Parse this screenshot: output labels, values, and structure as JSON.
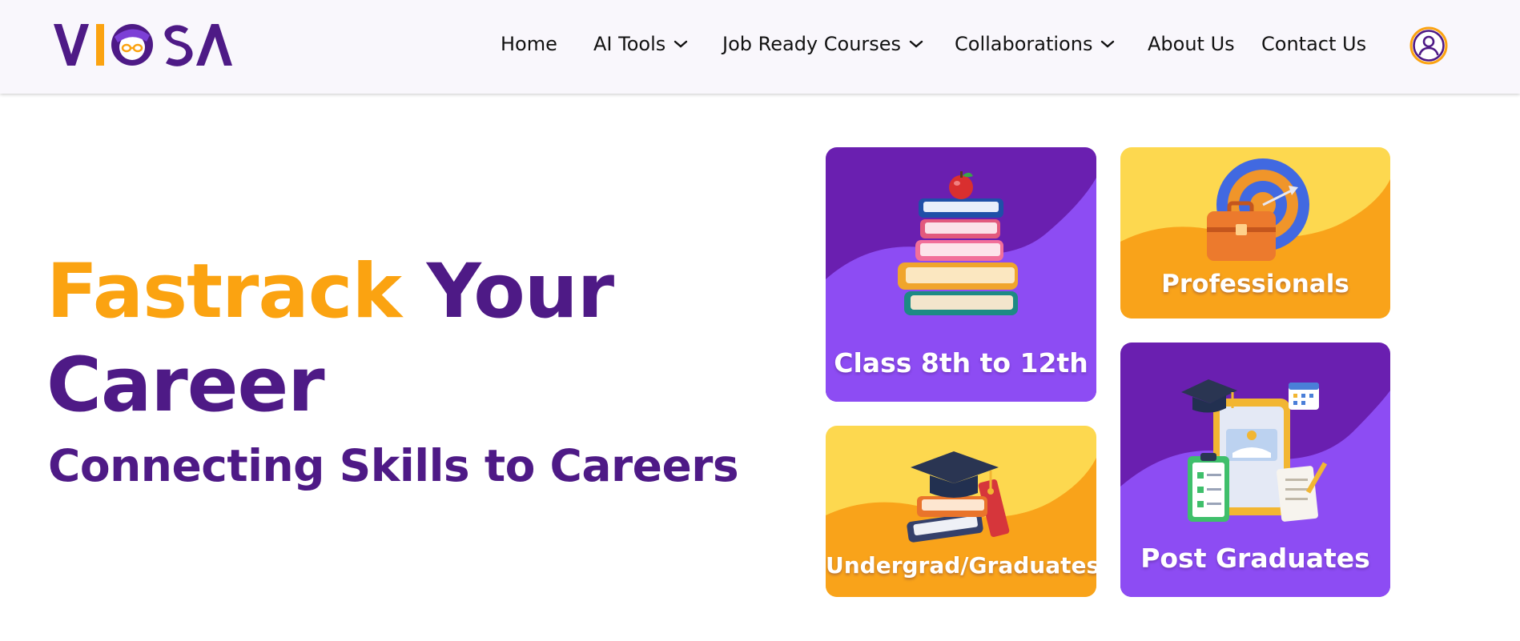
{
  "header": {
    "logo_text": "VIOSA",
    "nav": [
      {
        "label": "Home",
        "has_dropdown": false
      },
      {
        "label": "AI Tools",
        "has_dropdown": true
      },
      {
        "label": "Job Ready Courses",
        "has_dropdown": true
      },
      {
        "label": "Collaborations",
        "has_dropdown": true
      },
      {
        "label": "About Us",
        "has_dropdown": false
      },
      {
        "label": "Contact Us",
        "has_dropdown": false
      }
    ],
    "profile_icon": "user-circle-icon"
  },
  "hero": {
    "word_fastrack": "Fastrack",
    "word_your": "Your",
    "word_career": "Career",
    "subtitle": "Connecting Skills to Careers"
  },
  "cards": [
    {
      "label": "Class 8th to 12th",
      "icon": "books-apple-icon",
      "theme": "purple"
    },
    {
      "label": "Professionals",
      "icon": "briefcase-target-icon",
      "theme": "yellow"
    },
    {
      "label": "Undergrad/Graduates",
      "icon": "graduation-cap-books-icon",
      "theme": "yellow"
    },
    {
      "label": "Post Graduates",
      "icon": "online-learning-icon",
      "theme": "purple"
    }
  ],
  "colors": {
    "brand_purple": "#4e1a86",
    "brand_orange": "#fba311",
    "card_purple": "#6a1fb0",
    "card_purple_wave": "#8d4cf3",
    "card_yellow": "#fdd84f",
    "card_yellow_wave": "#f9a31a",
    "header_bg": "#f9f7fc"
  }
}
